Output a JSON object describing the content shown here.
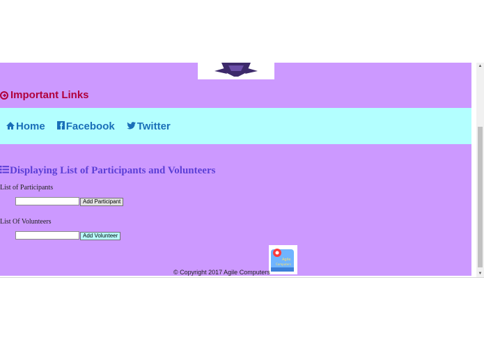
{
  "important_links": {
    "title": "Important Links"
  },
  "nav": {
    "home": "Home",
    "facebook": "Facebook",
    "twitter": "Twitter"
  },
  "section": {
    "title": "Displaying List of Participants and Volunteers"
  },
  "participants": {
    "label": "List of Participants",
    "input_value": "",
    "button": "Add Participant"
  },
  "volunteers": {
    "label": "List Of Volunteers",
    "input_value": "",
    "button": "Add Volunteer"
  },
  "footer": {
    "copyright": "© Copyright 2017 Agile Computers",
    "logo_text": "Agile Computers"
  },
  "colors": {
    "page_bg": "#cc99ff",
    "nav_band": "#b3ffff",
    "link": "#1a6fb8",
    "important": "#b0003a",
    "section_title": "#5b3fd6"
  },
  "icons": {
    "important_links": "circle-arrow-right-icon",
    "home": "home-icon",
    "facebook": "facebook-icon",
    "twitter": "twitter-icon",
    "section": "list-icon"
  }
}
